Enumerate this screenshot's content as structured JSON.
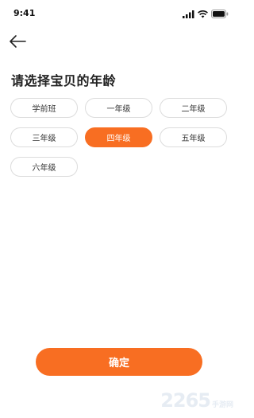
{
  "status_bar": {
    "time": "9:41",
    "icons": [
      "signal-icon",
      "wifi-icon",
      "battery-icon"
    ]
  },
  "header": {
    "back_icon": "arrow-left-icon"
  },
  "page": {
    "title": "请选择宝贝的年龄"
  },
  "grade_options": [
    {
      "label": "学前班",
      "selected": false
    },
    {
      "label": "一年级",
      "selected": false
    },
    {
      "label": "二年级",
      "selected": false
    },
    {
      "label": "三年级",
      "selected": false
    },
    {
      "label": "四年级",
      "selected": true
    },
    {
      "label": "五年级",
      "selected": false
    },
    {
      "label": "六年级",
      "selected": false
    }
  ],
  "confirm_label": "确定",
  "watermark": {
    "number": "2265",
    "text": "手游网"
  },
  "colors": {
    "accent": "#f86e22",
    "chip_border": "#dcdcdc",
    "text": "#222222"
  }
}
